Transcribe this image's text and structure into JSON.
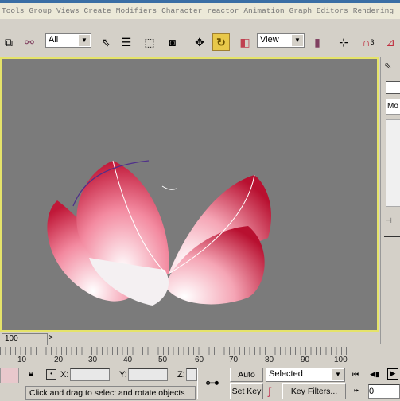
{
  "menu": [
    "Tools",
    "Group",
    "Views",
    "Create",
    "Modifiers",
    "Character",
    "reactor",
    "Animation",
    "Graph Editors",
    "Rendering"
  ],
  "toolbar": {
    "selection_filter": "All",
    "coord_system": "View",
    "snap_label": "3"
  },
  "viewport": {
    "border_color": "#e5e36a",
    "bg": "#7b7b7b"
  },
  "command_panel": {
    "modifier_tab": "Mo"
  },
  "timeline": {
    "slider": "100",
    "next": ">",
    "ticks": [
      "10",
      "20",
      "30",
      "40",
      "50",
      "60",
      "70",
      "80",
      "90",
      "100"
    ]
  },
  "status": {
    "x_label": "X:",
    "y_label": "Y:",
    "z_label": "Z:",
    "prompt": "Click and drag to select and rotate objects",
    "auto_key": "Auto Key",
    "set_key": "Set Key",
    "key_mode": "Selected",
    "key_filters": "Key Filters...",
    "frame": "0"
  }
}
